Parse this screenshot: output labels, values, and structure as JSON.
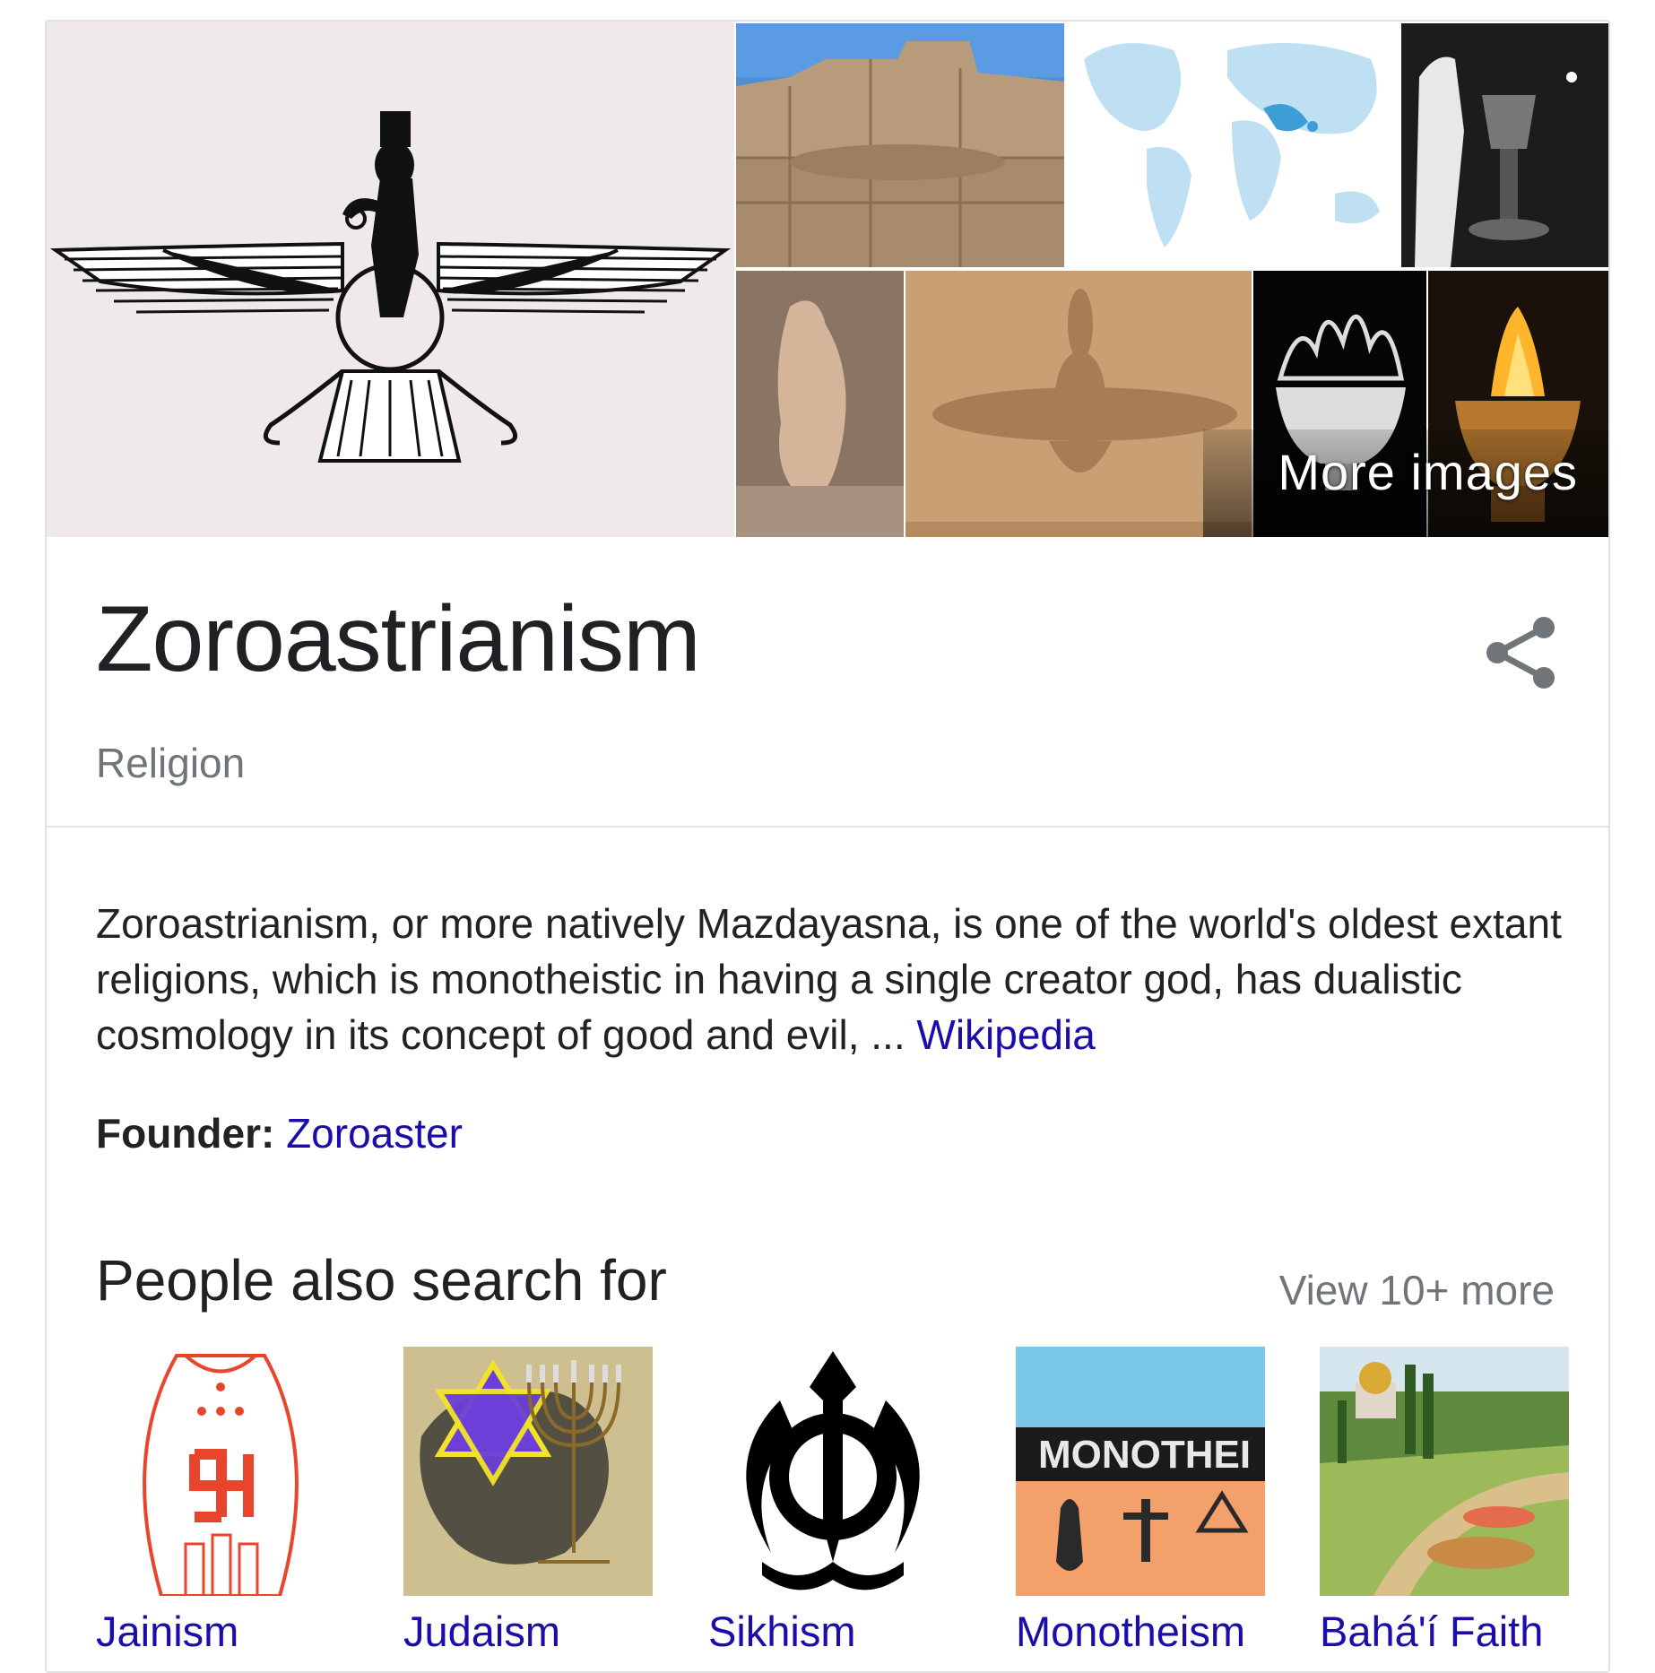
{
  "gallery": {
    "more_images_label": "More images"
  },
  "entity": {
    "title": "Zoroastrianism",
    "subtitle": "Religion"
  },
  "description": {
    "text": "Zoroastrianism, or more natively Mazdayasna, is one of the world's oldest extant religions, which is monotheistic in having a single creator god, has dualistic cosmology in its concept of good and evil, ... ",
    "source_link": "Wikipedia"
  },
  "founder": {
    "label": "Founder:",
    "value": "Zoroaster"
  },
  "people_also_search": {
    "title": "People also search for",
    "view_more": "View 10+ more",
    "items": [
      {
        "label": "Jainism"
      },
      {
        "label": "Judaism"
      },
      {
        "label": "Sikhism"
      },
      {
        "label": "Monotheism",
        "image_text": "MONOTHEI"
      },
      {
        "label": "Bahá'í Faith"
      }
    ]
  },
  "colors": {
    "link": "#1a0dab",
    "title": "#202124",
    "muted": "#70757a",
    "border": "#dfe1e5"
  }
}
